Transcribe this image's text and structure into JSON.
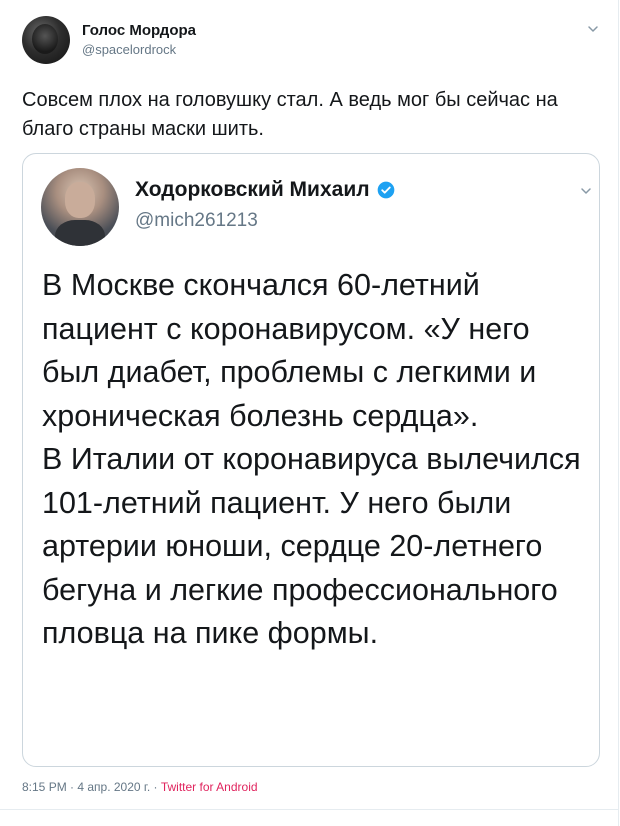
{
  "tweet": {
    "author_name": "Голос Мордора",
    "author_handle": "@spacelordrock",
    "text": "Совсем плох на головушку стал. А ведь мог бы сейчас на благо страны маски шить.",
    "timestamp": "8:15 PM · 4 апр. 2020 г. · ",
    "source": "Twitter for Android"
  },
  "quote": {
    "author_name": "Ходорковский Михаил",
    "author_handle": "@mich261213",
    "text": "В Москве скончался 60-летний пациент с коронавирусом. «У него был диабет, проблемы с легкими и хроническая болезнь сердца».\nВ Италии от коронавируса вылечился 101-летний пациент. У него были артерии юноши, сердце 20-летнего бегуна и легкие профессионального пловца на пике формы."
  },
  "icons": {
    "more": "chevron-down-icon",
    "verified": "verified-badge-icon"
  },
  "colors": {
    "text": "#14171a",
    "secondary": "#657786",
    "verified": "#1da1f2",
    "source_link": "#e0245e",
    "border": "#ccd6dd"
  }
}
